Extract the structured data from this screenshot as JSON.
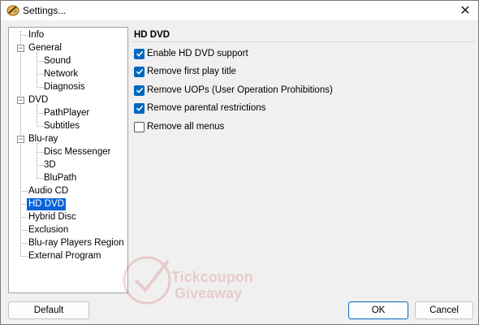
{
  "window": {
    "title": "Settings...",
    "close_glyph": "✕"
  },
  "tree": {
    "items": [
      {
        "label": "Info"
      },
      {
        "label": "General",
        "expander": "−"
      },
      {
        "label": "Sound"
      },
      {
        "label": "Network"
      },
      {
        "label": "Diagnosis"
      },
      {
        "label": "DVD",
        "expander": "−"
      },
      {
        "label": "PathPlayer"
      },
      {
        "label": "Subtitles"
      },
      {
        "label": "Blu-ray",
        "expander": "−"
      },
      {
        "label": "Disc Messenger"
      },
      {
        "label": "3D"
      },
      {
        "label": "BluPath"
      },
      {
        "label": "Audio CD"
      },
      {
        "label": "HD DVD",
        "selected": true
      },
      {
        "label": "Hybrid Disc"
      },
      {
        "label": "Exclusion"
      },
      {
        "label": "Blu-ray Players Region"
      },
      {
        "label": "External Program"
      }
    ]
  },
  "panel": {
    "title": "HD DVD",
    "options": [
      {
        "label": "Enable HD DVD support",
        "checked": true
      },
      {
        "label": "Remove first play title",
        "checked": true
      },
      {
        "label": "Remove UOPs (User Operation Prohibitions)",
        "checked": true
      },
      {
        "label": "Remove parental restrictions",
        "checked": true
      },
      {
        "label": "Remove all menus",
        "checked": false
      }
    ]
  },
  "buttons": {
    "default_label": "Default",
    "ok_label": "OK",
    "cancel_label": "Cancel"
  },
  "watermark": {
    "line1": "Tickcoupon",
    "line2": "Giveaway"
  },
  "colors": {
    "accent": "#0067c0",
    "selection": "#0a64d8"
  }
}
